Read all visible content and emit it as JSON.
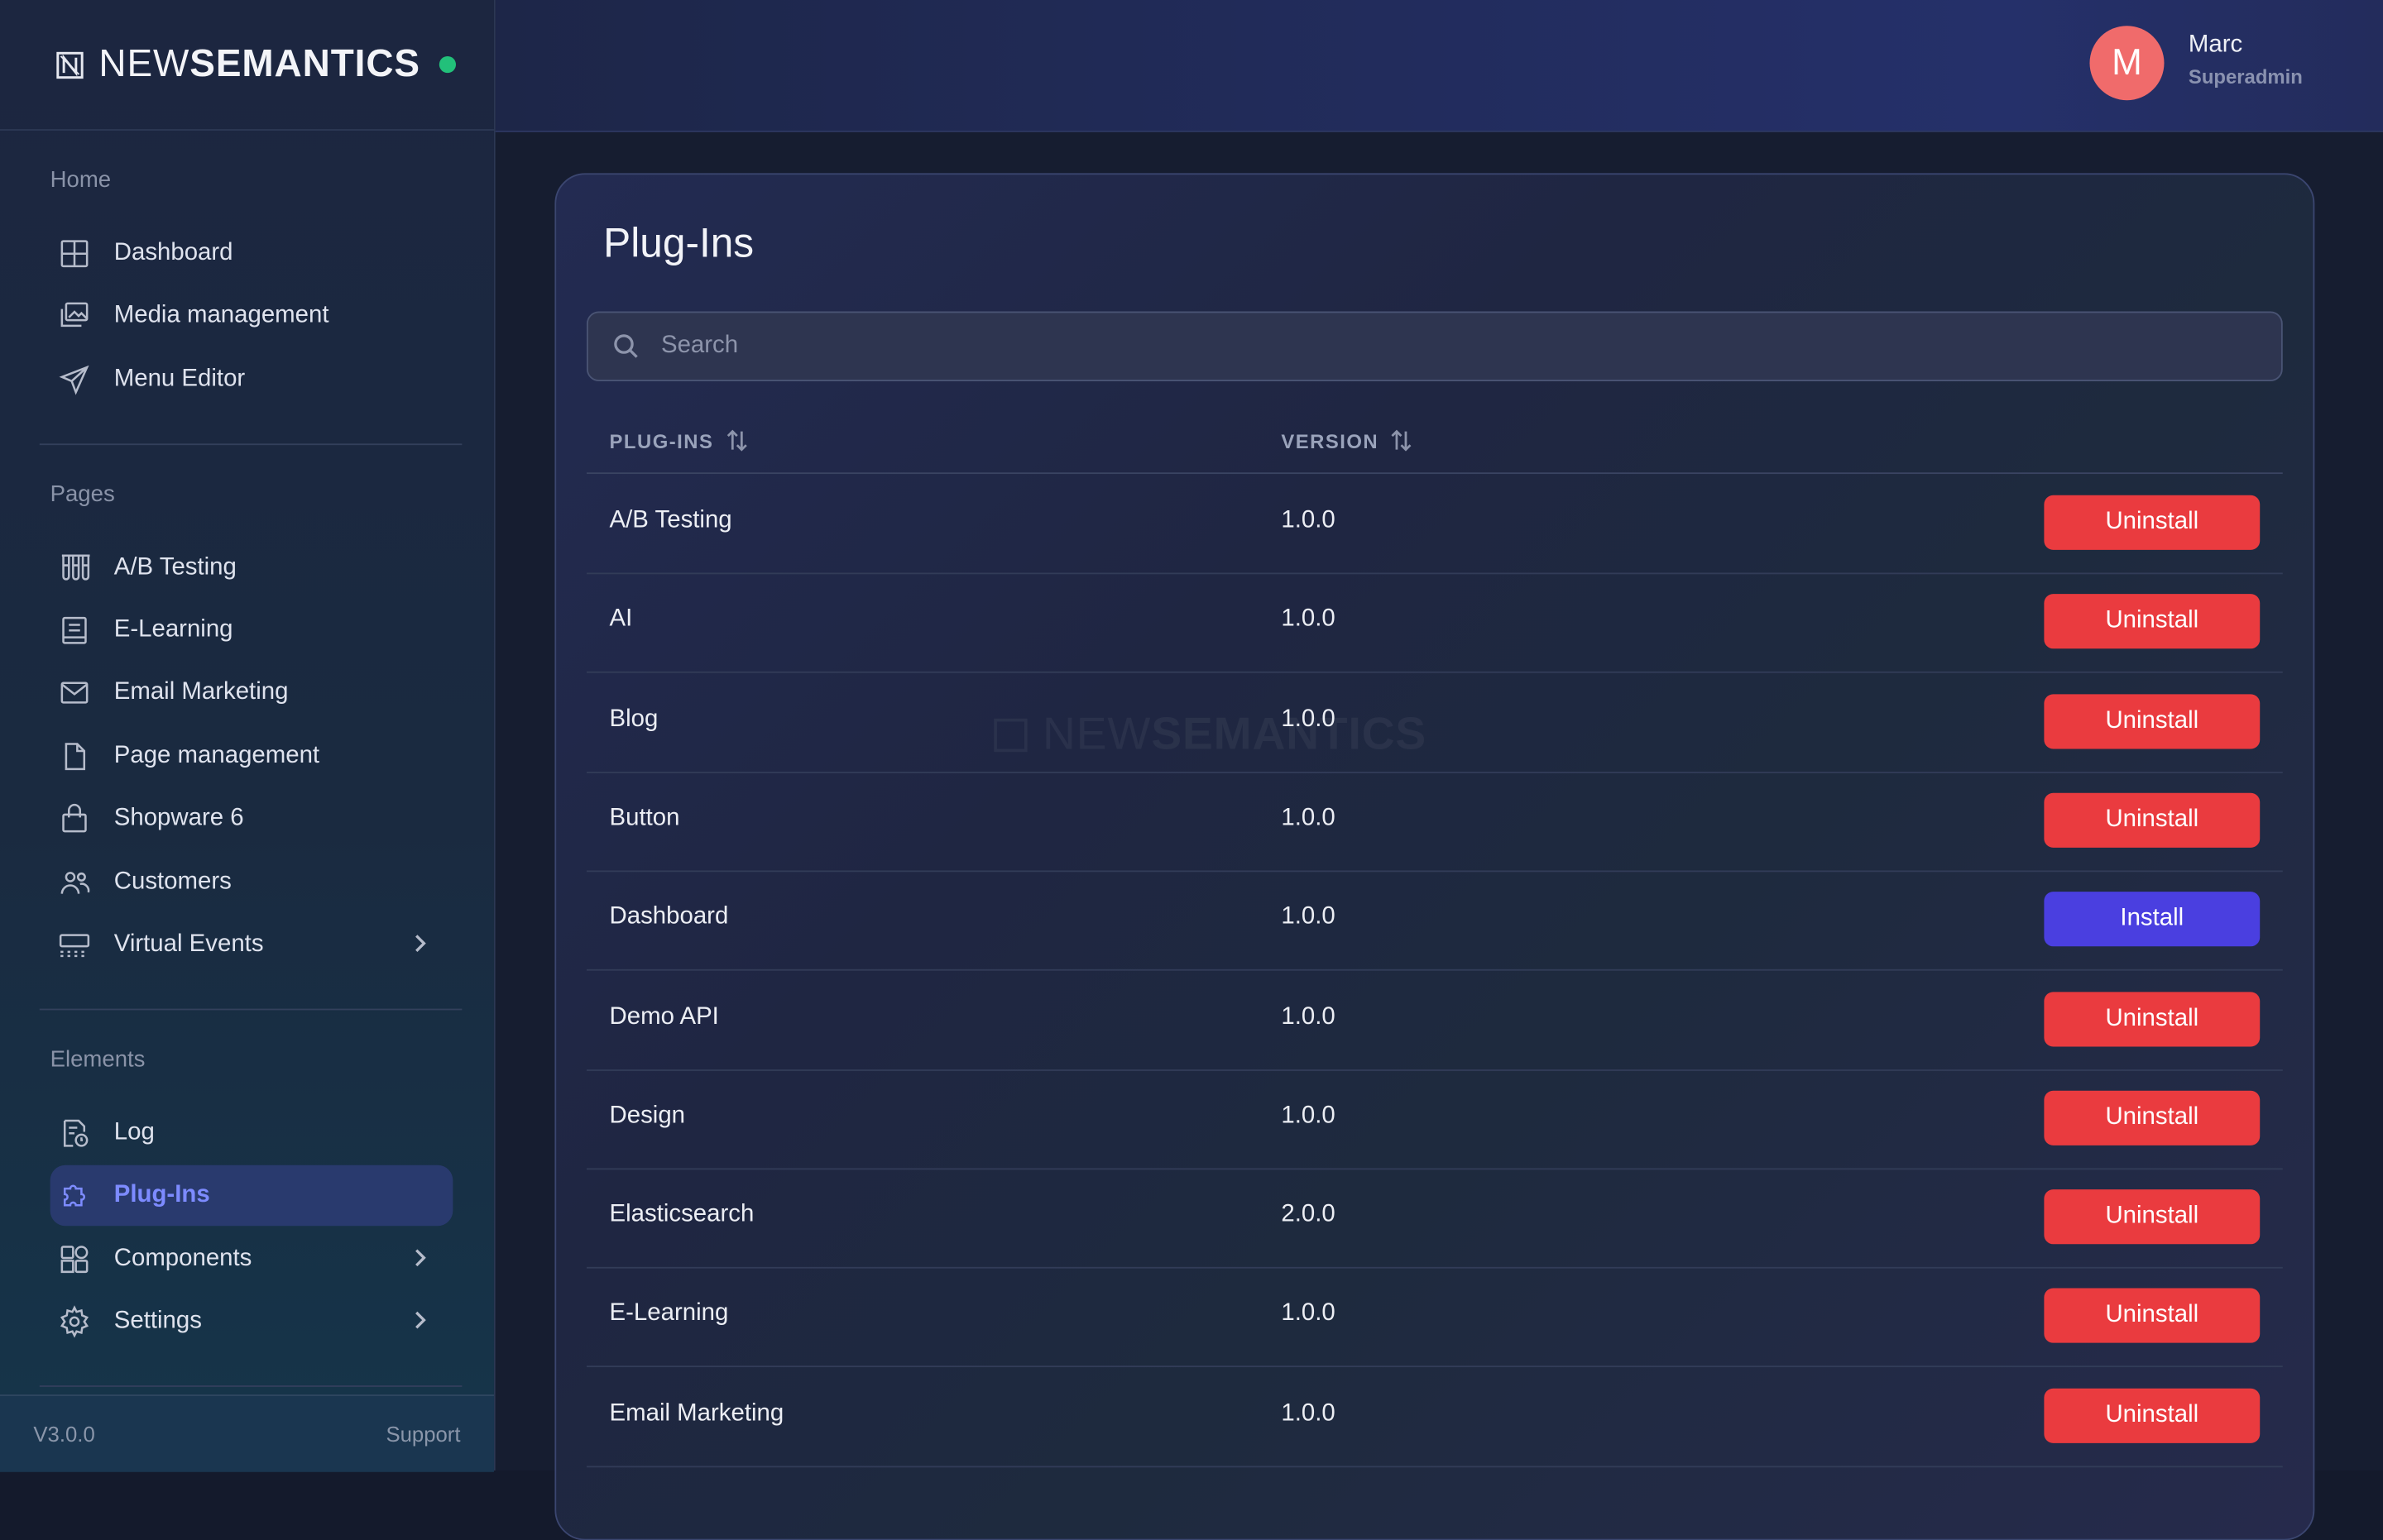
{
  "brand": {
    "name_light": "NEW",
    "name_bold": "SEMANTICS",
    "status_color": "#22c07a"
  },
  "user": {
    "initial": "M",
    "name": "Marc",
    "role": "Superadmin",
    "avatar_color": "#f06b6b"
  },
  "sidebar": {
    "sections": [
      {
        "label": "Home",
        "items": [
          {
            "label": "Dashboard",
            "icon": "grid-icon"
          },
          {
            "label": "Media management",
            "icon": "images-icon"
          },
          {
            "label": "Menu Editor",
            "icon": "send-icon"
          }
        ]
      },
      {
        "label": "Pages",
        "items": [
          {
            "label": "A/B Testing",
            "icon": "test-tubes-icon"
          },
          {
            "label": "E-Learning",
            "icon": "book-icon"
          },
          {
            "label": "Email Marketing",
            "icon": "mail-icon"
          },
          {
            "label": "Page management",
            "icon": "file-icon"
          },
          {
            "label": "Shopware 6",
            "icon": "shopping-bag-icon"
          },
          {
            "label": "Customers",
            "icon": "users-icon"
          },
          {
            "label": "Virtual Events",
            "icon": "events-icon",
            "has_submenu": true
          }
        ]
      },
      {
        "label": "Elements",
        "items": [
          {
            "label": "Log",
            "icon": "log-icon"
          },
          {
            "label": "Plug-Ins",
            "icon": "puzzle-icon",
            "active": true
          },
          {
            "label": "Components",
            "icon": "components-icon",
            "has_submenu": true
          },
          {
            "label": "Settings",
            "icon": "gear-icon",
            "has_submenu": true
          }
        ]
      }
    ],
    "footer": {
      "version": "V3.0.0",
      "support": "Support"
    }
  },
  "main": {
    "title": "Plug-Ins",
    "search_placeholder": "Search",
    "columns": [
      "PLUG-INS",
      "VERSION"
    ],
    "watermark_light": "NEW",
    "watermark_bold": "SEMANTICS",
    "rows": [
      {
        "name": "A/B Testing",
        "version": "1.0.0",
        "action": "Uninstall"
      },
      {
        "name": "AI",
        "version": "1.0.0",
        "action": "Uninstall"
      },
      {
        "name": "Blog",
        "version": "1.0.0",
        "action": "Uninstall"
      },
      {
        "name": "Button",
        "version": "1.0.0",
        "action": "Uninstall"
      },
      {
        "name": "Dashboard",
        "version": "1.0.0",
        "action": "Install"
      },
      {
        "name": "Demo API",
        "version": "1.0.0",
        "action": "Uninstall"
      },
      {
        "name": "Design",
        "version": "1.0.0",
        "action": "Uninstall"
      },
      {
        "name": "Elasticsearch",
        "version": "2.0.0",
        "action": "Uninstall"
      },
      {
        "name": "E-Learning",
        "version": "1.0.0",
        "action": "Uninstall"
      },
      {
        "name": "Email Marketing",
        "version": "1.0.0",
        "action": "Uninstall"
      }
    ]
  },
  "colors": {
    "uninstall": "#ea3b3f",
    "install": "#4a3fe0",
    "active_nav": "#7d8bff"
  }
}
